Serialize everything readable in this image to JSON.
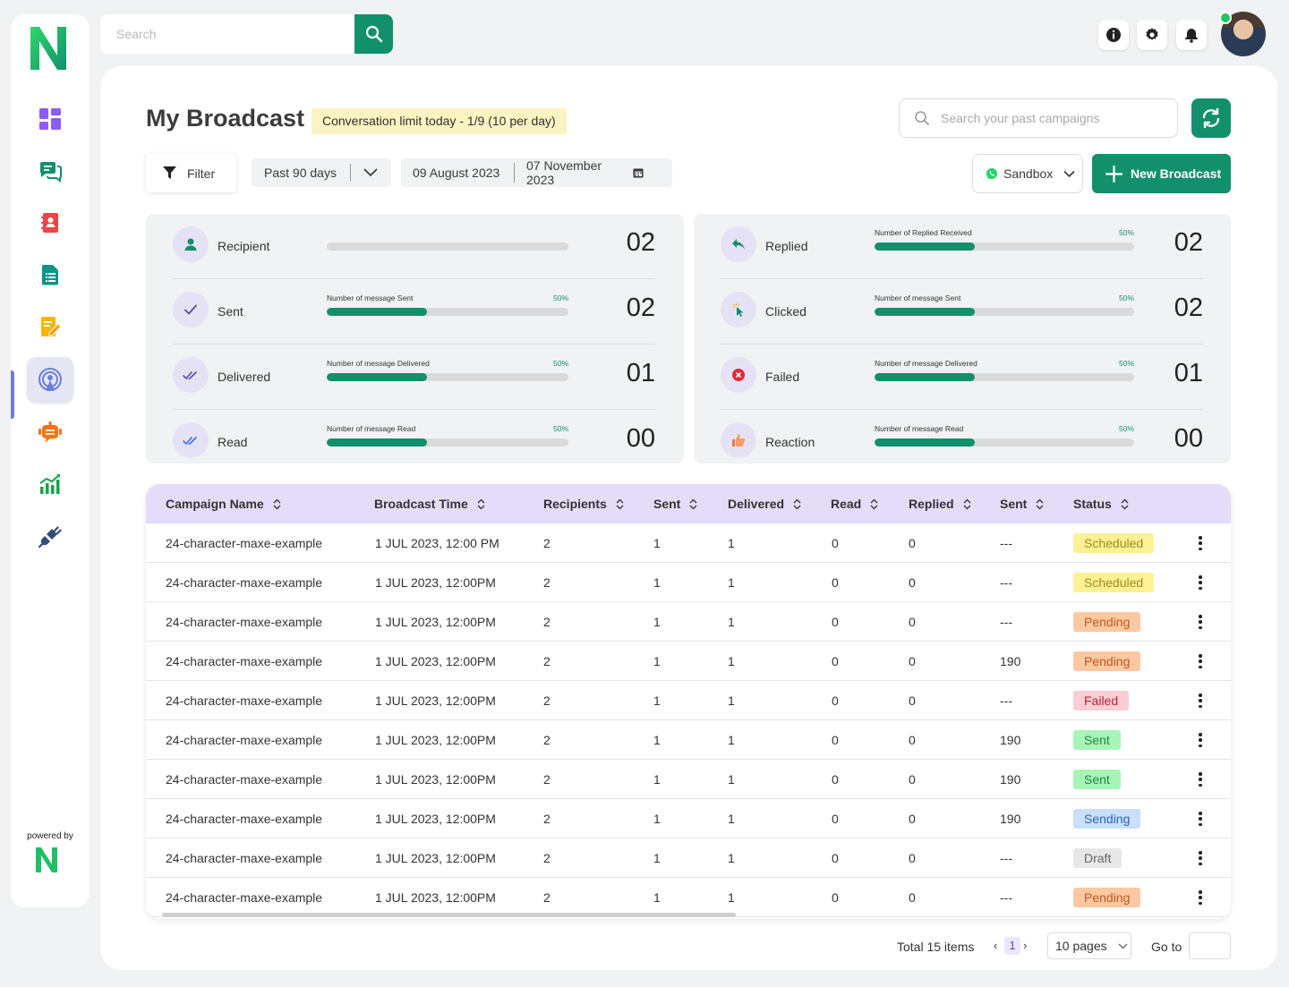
{
  "top_search": {
    "placeholder": "Search"
  },
  "sidebar": {
    "items": [
      {
        "name": "dashboard-icon",
        "color": "#8b5cf6"
      },
      {
        "name": "chat-icon",
        "color": "#12906c"
      },
      {
        "name": "contacts-icon",
        "color": "#ef4444"
      },
      {
        "name": "document-icon",
        "color": "#0d9488"
      },
      {
        "name": "notes-edit-icon",
        "color": "#f5b800"
      },
      {
        "name": "broadcast-icon",
        "color": "#6c7fd8",
        "active": true
      },
      {
        "name": "bot-icon",
        "color": "#f97316"
      },
      {
        "name": "analytics-icon",
        "color": "#16a34a"
      },
      {
        "name": "integrations-icon",
        "color": "#334e7a"
      }
    ],
    "powered_by": "powered by"
  },
  "header": {
    "title": "My Broadcast",
    "limit_badge": "Conversation limit today - 1/9 (10 per day)",
    "past_search_placeholder": "Search your past campaigns"
  },
  "toolbar": {
    "filter_label": "Filter",
    "range_label": "Past 90 days",
    "date_from": "09 August 2023",
    "date_to": "07 November 2023",
    "sandbox_label": "Sandbox",
    "new_broadcast_label": "New Broadcast"
  },
  "stats_left": [
    {
      "label": "Recipient",
      "caption": "",
      "pct_label": "",
      "fill": 0,
      "value": "02",
      "icon": "person-icon"
    },
    {
      "label": "Sent",
      "caption": "Number of message Sent",
      "pct_label": "50%",
      "fill": 0.415,
      "value": "02",
      "icon": "check-icon"
    },
    {
      "label": "Delivered",
      "caption": "Number of message Delivered",
      "pct_label": "50%",
      "fill": 0.415,
      "value": "01",
      "icon": "double-check-icon"
    },
    {
      "label": "Read",
      "caption": "Number of message Read",
      "pct_label": "50%",
      "fill": 0.415,
      "value": "00",
      "icon": "double-check-blue-icon"
    }
  ],
  "stats_right": [
    {
      "label": "Replied",
      "caption": "Number of Replied Received",
      "pct_label": "50%",
      "fill": 0.385,
      "value": "02",
      "icon": "reply-icon"
    },
    {
      "label": "Clicked",
      "caption": "Number of message Sent",
      "pct_label": "50%",
      "fill": 0.385,
      "value": "02",
      "icon": "click-icon"
    },
    {
      "label": "Failed",
      "caption": "Number of message Delivered",
      "pct_label": "50%",
      "fill": 0.385,
      "value": "01",
      "icon": "failed-icon"
    },
    {
      "label": "Reaction",
      "caption": "Number of message Read",
      "pct_label": "50%",
      "fill": 0.385,
      "value": "00",
      "icon": "thumbs-up-icon"
    }
  ],
  "table": {
    "columns": [
      "Campaign  Name",
      "Broadcast Time",
      "Recipients",
      "Sent",
      "Delivered",
      "Read",
      "Replied",
      "Sent",
      "Status"
    ],
    "rows": [
      {
        "name": "24-character-maxe-example",
        "time": "1 JUL 2023, 12:00 PM",
        "recipients": "2",
        "sent": "1",
        "delivered": "1",
        "read": "0",
        "replied": "0",
        "sent2": "---",
        "status": "Scheduled",
        "status_key": "scheduled"
      },
      {
        "name": "24-character-maxe-example",
        "time": "1 JUL 2023, 12:00PM",
        "recipients": "2",
        "sent": "1",
        "delivered": "1",
        "read": "0",
        "replied": "0",
        "sent2": "---",
        "status": "Scheduled",
        "status_key": "scheduled"
      },
      {
        "name": "24-character-maxe-example",
        "time": "1 JUL 2023, 12:00PM",
        "recipients": "2",
        "sent": "1",
        "delivered": "1",
        "read": "0",
        "replied": "0",
        "sent2": "---",
        "status": "Pending",
        "status_key": "pending"
      },
      {
        "name": "24-character-maxe-example",
        "time": "1 JUL 2023, 12:00PM",
        "recipients": "2",
        "sent": "1",
        "delivered": "1",
        "read": "0",
        "replied": "0",
        "sent2": "190",
        "status": "Pending",
        "status_key": "pending"
      },
      {
        "name": "24-character-maxe-example",
        "time": "1 JUL 2023, 12:00PM",
        "recipients": "2",
        "sent": "1",
        "delivered": "1",
        "read": "0",
        "replied": "0",
        "sent2": "---",
        "status": "Failed",
        "status_key": "failed"
      },
      {
        "name": "24-character-maxe-example",
        "time": "1 JUL 2023, 12:00PM",
        "recipients": "2",
        "sent": "1",
        "delivered": "1",
        "read": "0",
        "replied": "0",
        "sent2": "190",
        "status": "Sent",
        "status_key": "sent"
      },
      {
        "name": "24-character-maxe-example",
        "time": "1 JUL 2023, 12:00PM",
        "recipients": "2",
        "sent": "1",
        "delivered": "1",
        "read": "0",
        "replied": "0",
        "sent2": "190",
        "status": "Sent",
        "status_key": "sent"
      },
      {
        "name": "24-character-maxe-example",
        "time": "1 JUL 2023, 12:00PM",
        "recipients": "2",
        "sent": "1",
        "delivered": "1",
        "read": "0",
        "replied": "0",
        "sent2": "190",
        "status": "Sending",
        "status_key": "sending"
      },
      {
        "name": "24-character-maxe-example",
        "time": "1 JUL 2023, 12:00PM",
        "recipients": "2",
        "sent": "1",
        "delivered": "1",
        "read": "0",
        "replied": "0",
        "sent2": "---",
        "status": "Draft",
        "status_key": "draft"
      },
      {
        "name": "24-character-maxe-example",
        "time": "1 JUL 2023, 12:00PM",
        "recipients": "2",
        "sent": "1",
        "delivered": "1",
        "read": "0",
        "replied": "0",
        "sent2": "---",
        "status": "Pending",
        "status_key": "pending"
      }
    ]
  },
  "pagination": {
    "total": "Total 15 items",
    "prev": "‹",
    "current": "1",
    "next": "›",
    "page_size": "10 pages",
    "goto_label": "Go to"
  },
  "colors": {
    "primary": "#12906c",
    "header_row": "#e4dcf8",
    "stat_bg": "#f1f2f4"
  }
}
